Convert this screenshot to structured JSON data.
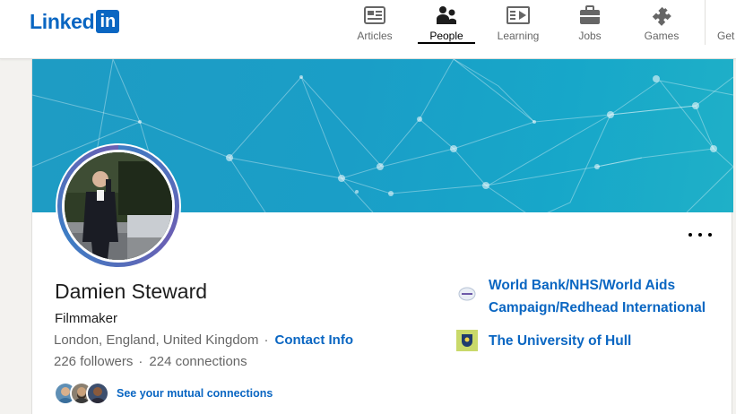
{
  "header": {
    "logo_text": "Linked",
    "logo_box": "in",
    "nav": [
      {
        "label": "Articles",
        "icon": "articles-icon",
        "active": false
      },
      {
        "label": "People",
        "icon": "people-icon",
        "active": true
      },
      {
        "label": "Learning",
        "icon": "learning-icon",
        "active": false
      },
      {
        "label": "Jobs",
        "icon": "jobs-icon",
        "active": false
      },
      {
        "label": "Games",
        "icon": "games-icon",
        "active": false
      },
      {
        "label": "Get",
        "icon": "",
        "active": false
      }
    ]
  },
  "profile": {
    "name": "Damien Steward",
    "headline": "Filmmaker",
    "location": "London, England, United Kingdom",
    "contact_info": "Contact Info",
    "followers": "226 followers",
    "connections": "224 connections",
    "mutual_connections": "See your mutual connections"
  },
  "experience": [
    {
      "name_line1": "World Bank/NHS/World Aids",
      "name_line2": "Campaign/Redhead International",
      "logo": "organization-logo-icon"
    },
    {
      "name_line1": "The University of Hull",
      "logo": "university-logo-icon"
    }
  ],
  "colors": {
    "brand": "#0a66c2",
    "banner": "#1e9cc4"
  }
}
